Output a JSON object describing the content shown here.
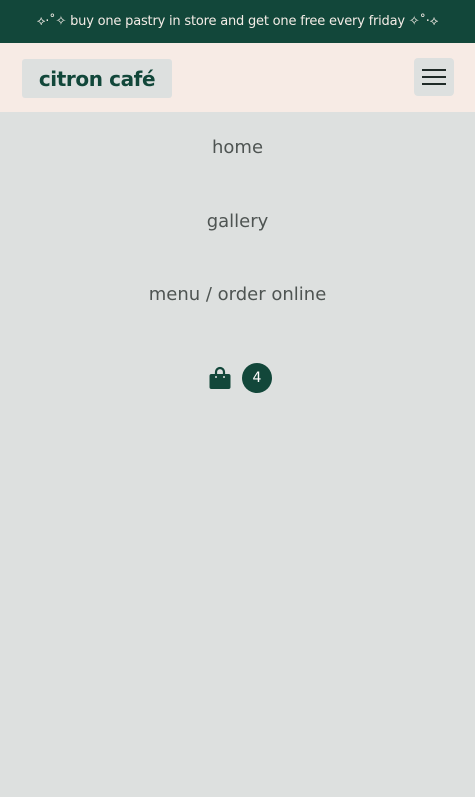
{
  "promo": {
    "text": "⟡·˚✧ buy one pastry in store and get one free every friday ✧˚·⟡"
  },
  "header": {
    "logo_text": "citron café",
    "menu_icon": "hamburger-menu-icon"
  },
  "nav": {
    "items": [
      {
        "label": "home"
      },
      {
        "label": "gallery"
      },
      {
        "label": "menu / order online"
      }
    ]
  },
  "cart": {
    "icon": "shopping-bag-icon",
    "count": "4"
  },
  "colors": {
    "brand_dark_green": "#12473a",
    "header_bg": "#f7ebe5",
    "page_bg": "#dde0df",
    "nav_text": "#4e5452"
  }
}
